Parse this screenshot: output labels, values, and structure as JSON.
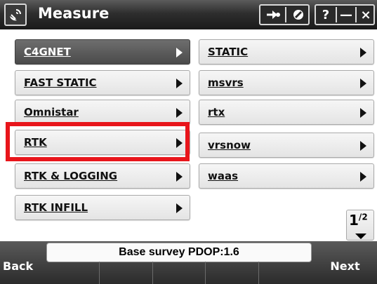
{
  "window": {
    "title": "Measure",
    "icons": {
      "app": "satellite-dish-icon",
      "map": "map-arrow-icon",
      "gps": "gps-status-icon",
      "help": "?",
      "minimize": "—",
      "close": "×"
    }
  },
  "styles": {
    "left": [
      {
        "label": "C4GNET",
        "selected": true
      },
      {
        "label": "FAST STATIC",
        "selected": false
      },
      {
        "label": "Omnistar",
        "selected": false
      },
      {
        "label": "RTK",
        "selected": false
      },
      {
        "label": "RTK & LOGGING",
        "selected": false
      },
      {
        "label": "RTK INFILL",
        "selected": false
      }
    ],
    "right": [
      {
        "label": "STATIC",
        "selected": false
      },
      {
        "label": "msvrs",
        "selected": false
      },
      {
        "label": "rtx",
        "selected": false
      },
      {
        "label": "vrsnow",
        "selected": false
      },
      {
        "label": "waas",
        "selected": false
      }
    ]
  },
  "pager": {
    "current": "1",
    "total": "2"
  },
  "status": {
    "text": "Base survey  PDOP:1.6"
  },
  "footer": {
    "back_label": "Back",
    "next_label": "Next"
  },
  "colors": {
    "highlight": "#e8151b",
    "selected_bg": "#5a5a5a"
  }
}
